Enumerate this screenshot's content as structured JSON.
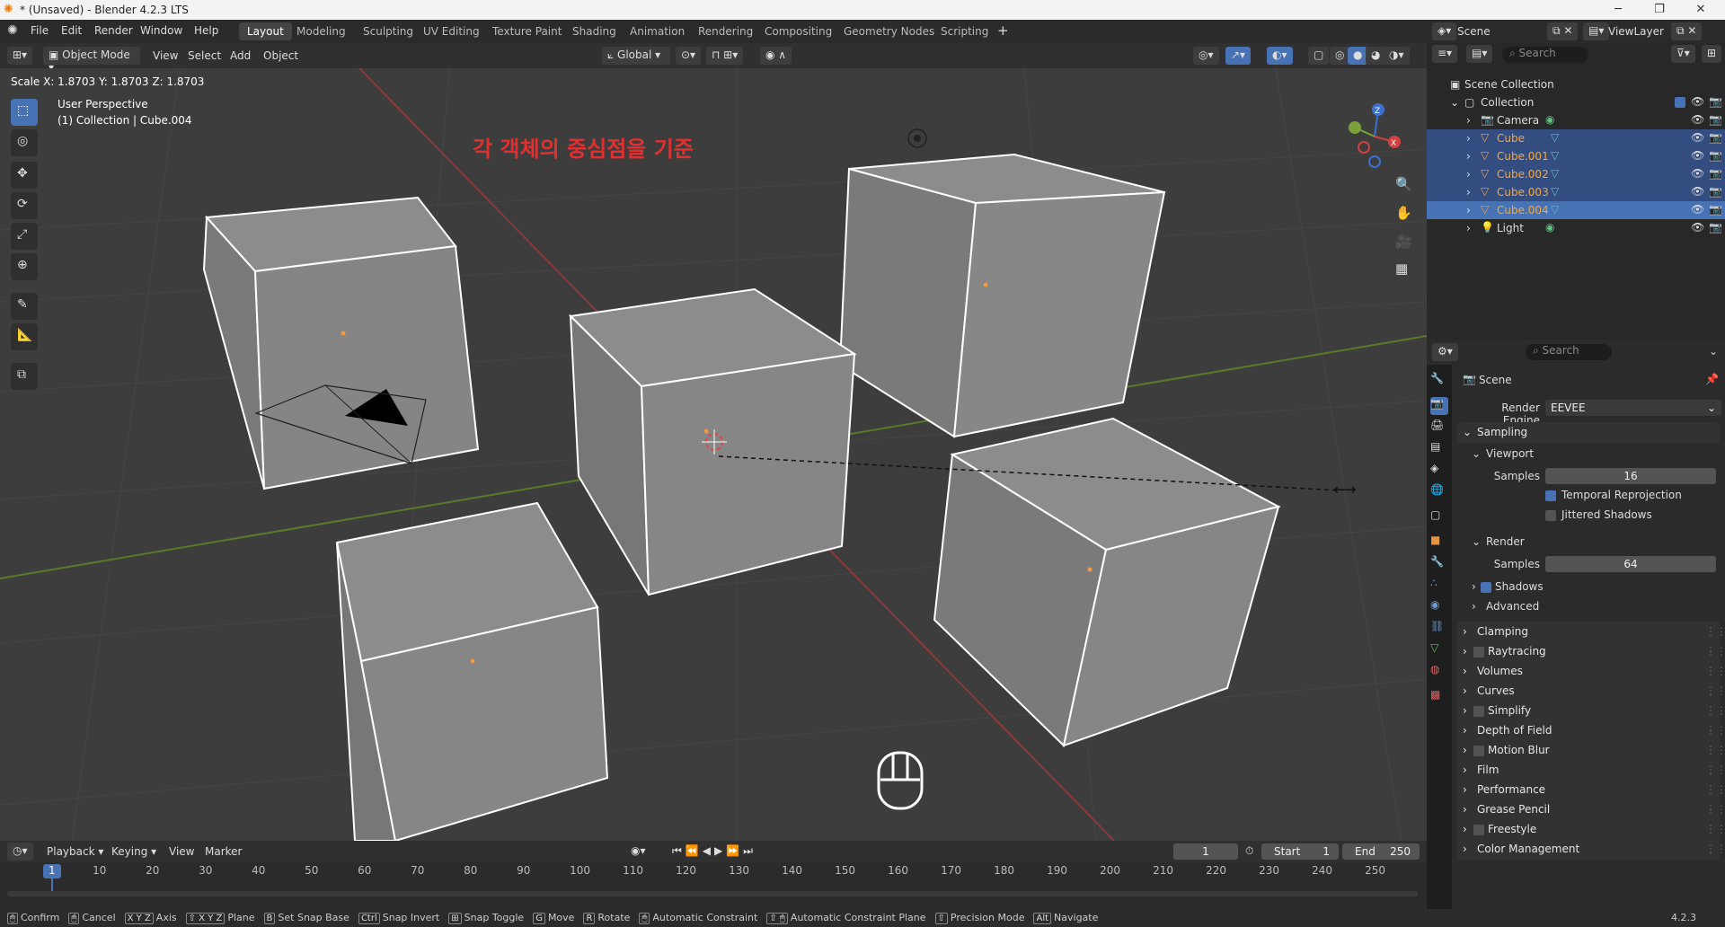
{
  "window": {
    "title": "* (Unsaved) - Blender 4.2.3 LTS",
    "minimize": "─",
    "maximize": "❐",
    "close": "✕"
  },
  "menu": [
    "File",
    "Edit",
    "Render",
    "Window",
    "Help"
  ],
  "workspaces": [
    "Layout",
    "Modeling",
    "Sculpting",
    "UV Editing",
    "Texture Paint",
    "Shading",
    "Animation",
    "Rendering",
    "Compositing",
    "Geometry Nodes",
    "Scripting"
  ],
  "active_workspace": "Layout",
  "scene": {
    "name": "Scene",
    "view_layer": "ViewLayer"
  },
  "viewport_header": {
    "mode": "Object Mode",
    "menus": [
      "View",
      "Select",
      "Add",
      "Object"
    ],
    "orientation": "Global"
  },
  "viewport": {
    "scale_info": "Scale X: 1.8703   Y: 1.8703   Z: 1.8703",
    "perspective": "User Perspective",
    "collection_info": "(1) Collection | Cube.004",
    "annotation": "각 객체의 중심점을 기준",
    "axes": {
      "x": "X",
      "y": "Y",
      "z": "Z"
    }
  },
  "outliner": {
    "search_placeholder": "Search",
    "root": "Scene Collection",
    "collection": "Collection",
    "items": [
      {
        "name": "Camera",
        "type": "camera"
      },
      {
        "name": "Cube",
        "type": "mesh"
      },
      {
        "name": "Cube.001",
        "type": "mesh"
      },
      {
        "name": "Cube.002",
        "type": "mesh"
      },
      {
        "name": "Cube.003",
        "type": "mesh"
      },
      {
        "name": "Cube.004",
        "type": "mesh"
      },
      {
        "name": "Light",
        "type": "light"
      }
    ]
  },
  "properties": {
    "search_placeholder": "Search",
    "context": "Scene",
    "render_engine_label": "Render Engine",
    "render_engine": "EEVEE",
    "sampling": "Sampling",
    "viewport": "Viewport",
    "samples_label": "Samples",
    "viewport_samples": "16",
    "temporal_reprojection": "Temporal Reprojection",
    "jittered_shadows": "Jittered Shadows",
    "render": "Render",
    "render_samples": "64",
    "shadows": "Shadows",
    "advanced": "Advanced",
    "sections": [
      "Clamping",
      "Raytracing",
      "Volumes",
      "Curves",
      "Simplify",
      "Depth of Field",
      "Motion Blur",
      "Film",
      "Performance",
      "Grease Pencil",
      "Freestyle",
      "Color Management"
    ]
  },
  "timeline": {
    "menus": [
      "Playback",
      "Keying",
      "View",
      "Marker"
    ],
    "current_frame": "1",
    "start_label": "Start",
    "start": "1",
    "end_label": "End",
    "end": "250",
    "ticks": [
      "1",
      "10",
      "20",
      "30",
      "40",
      "50",
      "60",
      "70",
      "80",
      "90",
      "100",
      "110",
      "120",
      "130",
      "140",
      "150",
      "160",
      "170",
      "180",
      "190",
      "200",
      "210",
      "220",
      "230",
      "240",
      "250"
    ]
  },
  "statusbar": {
    "items": [
      "Confirm",
      "Cancel",
      "Axis",
      "Plane",
      "Set Snap Base",
      "Snap Invert",
      "Snap Toggle",
      "Move",
      "Rotate",
      "Automatic Constraint",
      "Automatic Constraint Plane",
      "Precision Mode",
      "Navigate"
    ],
    "version": "4.2.3"
  },
  "colors": {
    "accent": "#4772b3",
    "selected": "#334d80",
    "annotation": "#e23030",
    "object_orange": "#f59a3c"
  }
}
